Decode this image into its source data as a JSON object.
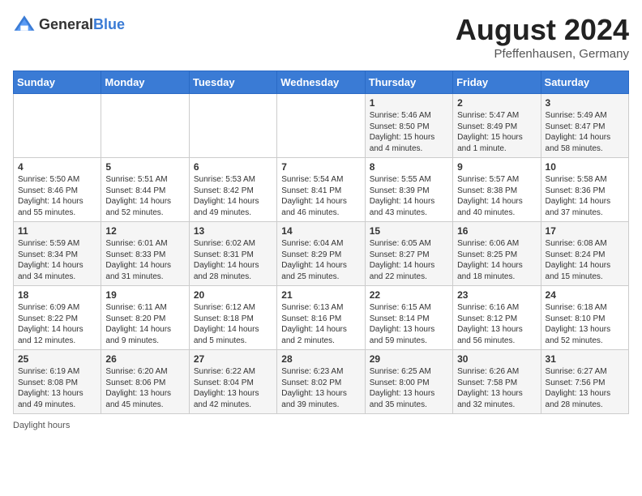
{
  "header": {
    "logo_general": "General",
    "logo_blue": "Blue",
    "month_year": "August 2024",
    "location": "Pfeffenhausen, Germany"
  },
  "weekdays": [
    "Sunday",
    "Monday",
    "Tuesday",
    "Wednesday",
    "Thursday",
    "Friday",
    "Saturday"
  ],
  "footer": {
    "daylight_label": "Daylight hours"
  },
  "weeks": [
    [
      {
        "day": "",
        "info": ""
      },
      {
        "day": "",
        "info": ""
      },
      {
        "day": "",
        "info": ""
      },
      {
        "day": "",
        "info": ""
      },
      {
        "day": "1",
        "info": "Sunrise: 5:46 AM\nSunset: 8:50 PM\nDaylight: 15 hours\nand 4 minutes."
      },
      {
        "day": "2",
        "info": "Sunrise: 5:47 AM\nSunset: 8:49 PM\nDaylight: 15 hours\nand 1 minute."
      },
      {
        "day": "3",
        "info": "Sunrise: 5:49 AM\nSunset: 8:47 PM\nDaylight: 14 hours\nand 58 minutes."
      }
    ],
    [
      {
        "day": "4",
        "info": "Sunrise: 5:50 AM\nSunset: 8:46 PM\nDaylight: 14 hours\nand 55 minutes."
      },
      {
        "day": "5",
        "info": "Sunrise: 5:51 AM\nSunset: 8:44 PM\nDaylight: 14 hours\nand 52 minutes."
      },
      {
        "day": "6",
        "info": "Sunrise: 5:53 AM\nSunset: 8:42 PM\nDaylight: 14 hours\nand 49 minutes."
      },
      {
        "day": "7",
        "info": "Sunrise: 5:54 AM\nSunset: 8:41 PM\nDaylight: 14 hours\nand 46 minutes."
      },
      {
        "day": "8",
        "info": "Sunrise: 5:55 AM\nSunset: 8:39 PM\nDaylight: 14 hours\nand 43 minutes."
      },
      {
        "day": "9",
        "info": "Sunrise: 5:57 AM\nSunset: 8:38 PM\nDaylight: 14 hours\nand 40 minutes."
      },
      {
        "day": "10",
        "info": "Sunrise: 5:58 AM\nSunset: 8:36 PM\nDaylight: 14 hours\nand 37 minutes."
      }
    ],
    [
      {
        "day": "11",
        "info": "Sunrise: 5:59 AM\nSunset: 8:34 PM\nDaylight: 14 hours\nand 34 minutes."
      },
      {
        "day": "12",
        "info": "Sunrise: 6:01 AM\nSunset: 8:33 PM\nDaylight: 14 hours\nand 31 minutes."
      },
      {
        "day": "13",
        "info": "Sunrise: 6:02 AM\nSunset: 8:31 PM\nDaylight: 14 hours\nand 28 minutes."
      },
      {
        "day": "14",
        "info": "Sunrise: 6:04 AM\nSunset: 8:29 PM\nDaylight: 14 hours\nand 25 minutes."
      },
      {
        "day": "15",
        "info": "Sunrise: 6:05 AM\nSunset: 8:27 PM\nDaylight: 14 hours\nand 22 minutes."
      },
      {
        "day": "16",
        "info": "Sunrise: 6:06 AM\nSunset: 8:25 PM\nDaylight: 14 hours\nand 18 minutes."
      },
      {
        "day": "17",
        "info": "Sunrise: 6:08 AM\nSunset: 8:24 PM\nDaylight: 14 hours\nand 15 minutes."
      }
    ],
    [
      {
        "day": "18",
        "info": "Sunrise: 6:09 AM\nSunset: 8:22 PM\nDaylight: 14 hours\nand 12 minutes."
      },
      {
        "day": "19",
        "info": "Sunrise: 6:11 AM\nSunset: 8:20 PM\nDaylight: 14 hours\nand 9 minutes."
      },
      {
        "day": "20",
        "info": "Sunrise: 6:12 AM\nSunset: 8:18 PM\nDaylight: 14 hours\nand 5 minutes."
      },
      {
        "day": "21",
        "info": "Sunrise: 6:13 AM\nSunset: 8:16 PM\nDaylight: 14 hours\nand 2 minutes."
      },
      {
        "day": "22",
        "info": "Sunrise: 6:15 AM\nSunset: 8:14 PM\nDaylight: 13 hours\nand 59 minutes."
      },
      {
        "day": "23",
        "info": "Sunrise: 6:16 AM\nSunset: 8:12 PM\nDaylight: 13 hours\nand 56 minutes."
      },
      {
        "day": "24",
        "info": "Sunrise: 6:18 AM\nSunset: 8:10 PM\nDaylight: 13 hours\nand 52 minutes."
      }
    ],
    [
      {
        "day": "25",
        "info": "Sunrise: 6:19 AM\nSunset: 8:08 PM\nDaylight: 13 hours\nand 49 minutes."
      },
      {
        "day": "26",
        "info": "Sunrise: 6:20 AM\nSunset: 8:06 PM\nDaylight: 13 hours\nand 45 minutes."
      },
      {
        "day": "27",
        "info": "Sunrise: 6:22 AM\nSunset: 8:04 PM\nDaylight: 13 hours\nand 42 minutes."
      },
      {
        "day": "28",
        "info": "Sunrise: 6:23 AM\nSunset: 8:02 PM\nDaylight: 13 hours\nand 39 minutes."
      },
      {
        "day": "29",
        "info": "Sunrise: 6:25 AM\nSunset: 8:00 PM\nDaylight: 13 hours\nand 35 minutes."
      },
      {
        "day": "30",
        "info": "Sunrise: 6:26 AM\nSunset: 7:58 PM\nDaylight: 13 hours\nand 32 minutes."
      },
      {
        "day": "31",
        "info": "Sunrise: 6:27 AM\nSunset: 7:56 PM\nDaylight: 13 hours\nand 28 minutes."
      }
    ]
  ]
}
